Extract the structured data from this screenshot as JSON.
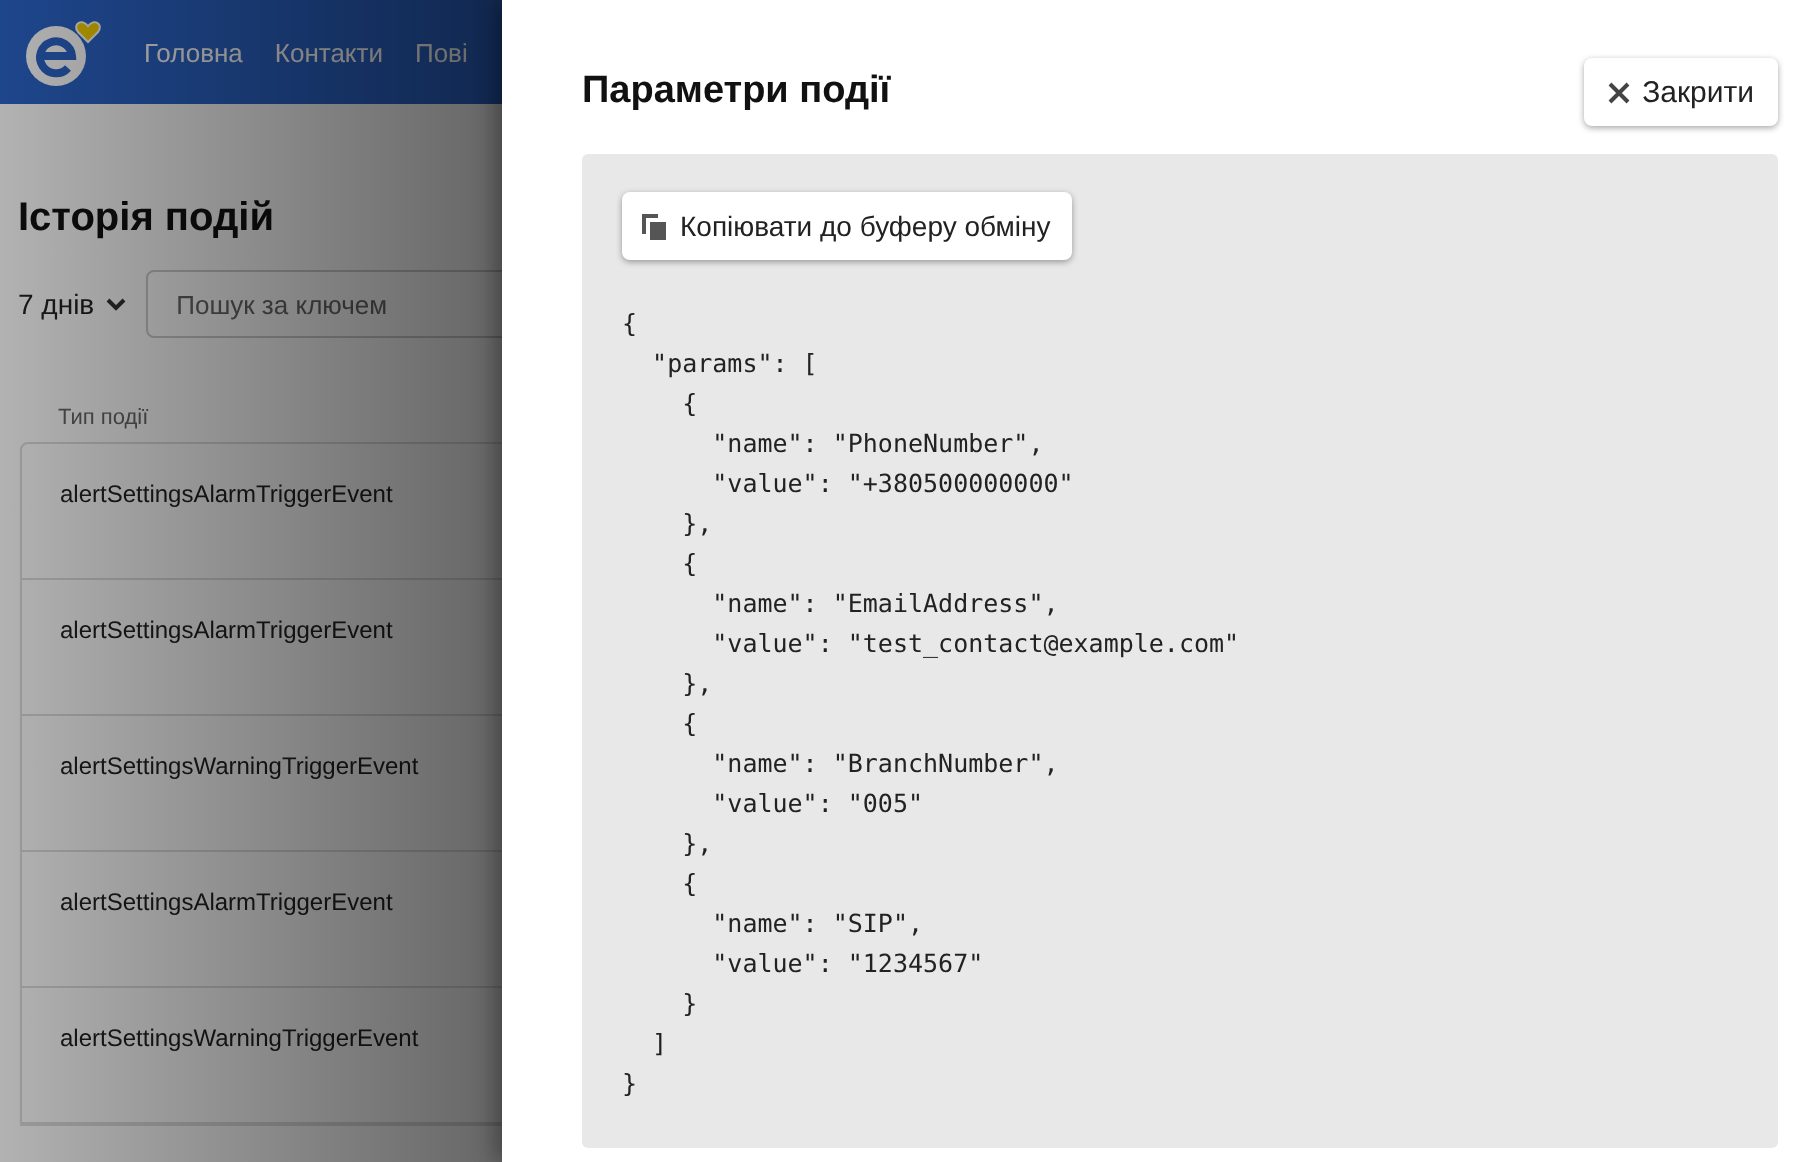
{
  "nav": {
    "items": [
      "Головна",
      "Контакти",
      "Пові"
    ]
  },
  "page": {
    "title": "Історія подій",
    "period": "7 днів",
    "search": {
      "placeholder": "Пошук за ключем"
    },
    "table": {
      "columns": [
        "Тип події"
      ],
      "rows": [
        "alertSettingsAlarmTriggerEvent",
        "alertSettingsAlarmTriggerEvent",
        "alertSettingsWarningTriggerEvent",
        "alertSettingsAlarmTriggerEvent",
        "alertSettingsWarningTriggerEvent"
      ]
    }
  },
  "drawer": {
    "title": "Параметри події",
    "close_button": "Закрити",
    "copy_button": "Копіювати до буферу обміну",
    "code_lines": [
      "{",
      "  \"params\": [",
      "    {",
      "      \"name\": \"PhoneNumber\",",
      "      \"value\": \"+380500000000\"",
      "    },",
      "    {",
      "      \"name\": \"EmailAddress\",",
      "      \"value\": \"test_contact@example.com\"",
      "    },",
      "    {",
      "      \"name\": \"BranchNumber\",",
      "      \"value\": \"005\"",
      "    },",
      "    {",
      "      \"name\": \"SIP\",",
      "      \"value\": \"1234567\"",
      "    }",
      "  ]",
      "}"
    ]
  }
}
